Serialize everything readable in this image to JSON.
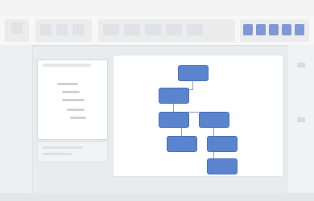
{
  "window": {
    "title": ""
  },
  "ribbon": {
    "tabs": [
      "",
      "",
      "",
      "",
      "",
      "",
      ""
    ],
    "paste_label": ""
  },
  "text_pane": {
    "items": [
      "",
      "",
      "",
      "",
      ""
    ]
  },
  "smartart": {
    "nodes": [
      "",
      "",
      "",
      "",
      "",
      ""
    ]
  },
  "colors": {
    "node_fill": "#5b84cf",
    "node_border": "#4b73bd",
    "accent": "#7f98d6"
  }
}
